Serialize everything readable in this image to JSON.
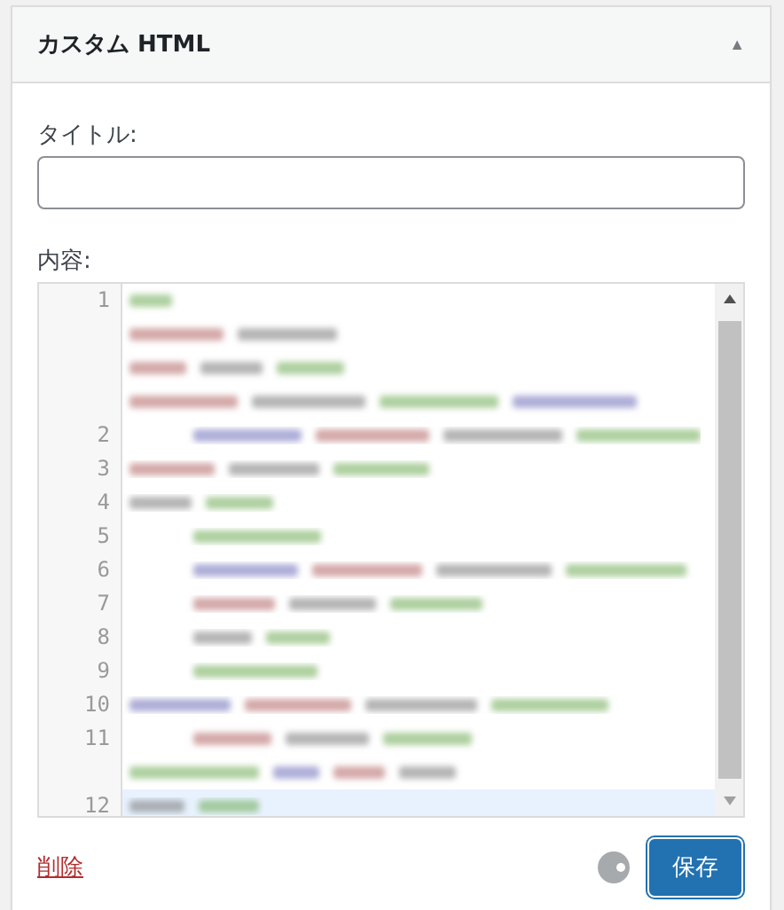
{
  "widget": {
    "title": "カスタム HTML",
    "toggle": "▲",
    "expanded": true
  },
  "title_field": {
    "label": "タイトル:"
  },
  "content": {
    "label": "内容:",
    "lines": [
      {
        "number": "1",
        "active": false,
        "kind": "quadruple"
      },
      {
        "number": "2",
        "active": false,
        "kind": "single"
      },
      {
        "number": "3",
        "active": false,
        "kind": "single"
      },
      {
        "number": "4",
        "active": false,
        "kind": "single"
      },
      {
        "number": "5",
        "active": false,
        "kind": "single"
      },
      {
        "number": "6",
        "active": false,
        "kind": "single"
      },
      {
        "number": "7",
        "active": false,
        "kind": "single"
      },
      {
        "number": "8",
        "active": false,
        "kind": "single"
      },
      {
        "number": "9",
        "active": false,
        "kind": "single"
      },
      {
        "number": "10",
        "active": false,
        "kind": "single"
      },
      {
        "number": "11",
        "active": false,
        "kind": "double"
      },
      {
        "number": "12",
        "active": true,
        "kind": "single"
      }
    ]
  },
  "footer": {
    "delete_link": "削除",
    "save_button": "保存"
  }
}
